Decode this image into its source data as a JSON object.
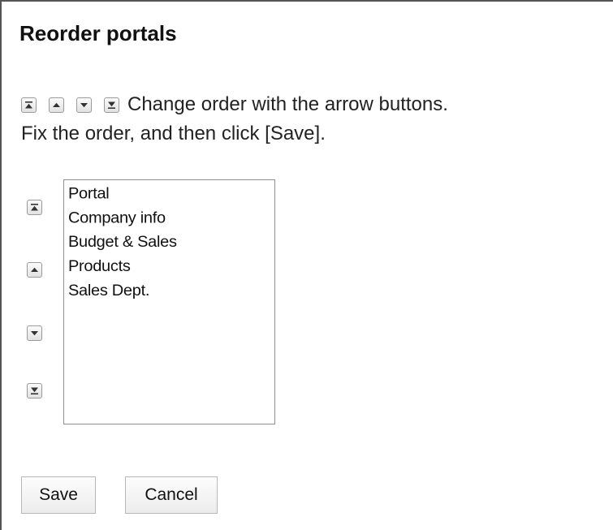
{
  "dialog": {
    "title": "Reorder portals",
    "instruction_line1": "Change order with the arrow buttons.",
    "instruction_line2": "Fix the order, and then click [Save]."
  },
  "icons": {
    "move_top": "move-to-top-icon",
    "move_up": "move-up-icon",
    "move_down": "move-down-icon",
    "move_bottom": "move-to-bottom-icon"
  },
  "portal_list": {
    "items": [
      "Portal",
      "Company info",
      "Budget & Sales",
      "Products",
      "Sales Dept."
    ]
  },
  "actions": {
    "save_label": "Save",
    "cancel_label": "Cancel"
  },
  "colors": {
    "button_border": "#9a9a9a",
    "arrow_fill": "#333333",
    "list_border": "#8f8f8f"
  }
}
